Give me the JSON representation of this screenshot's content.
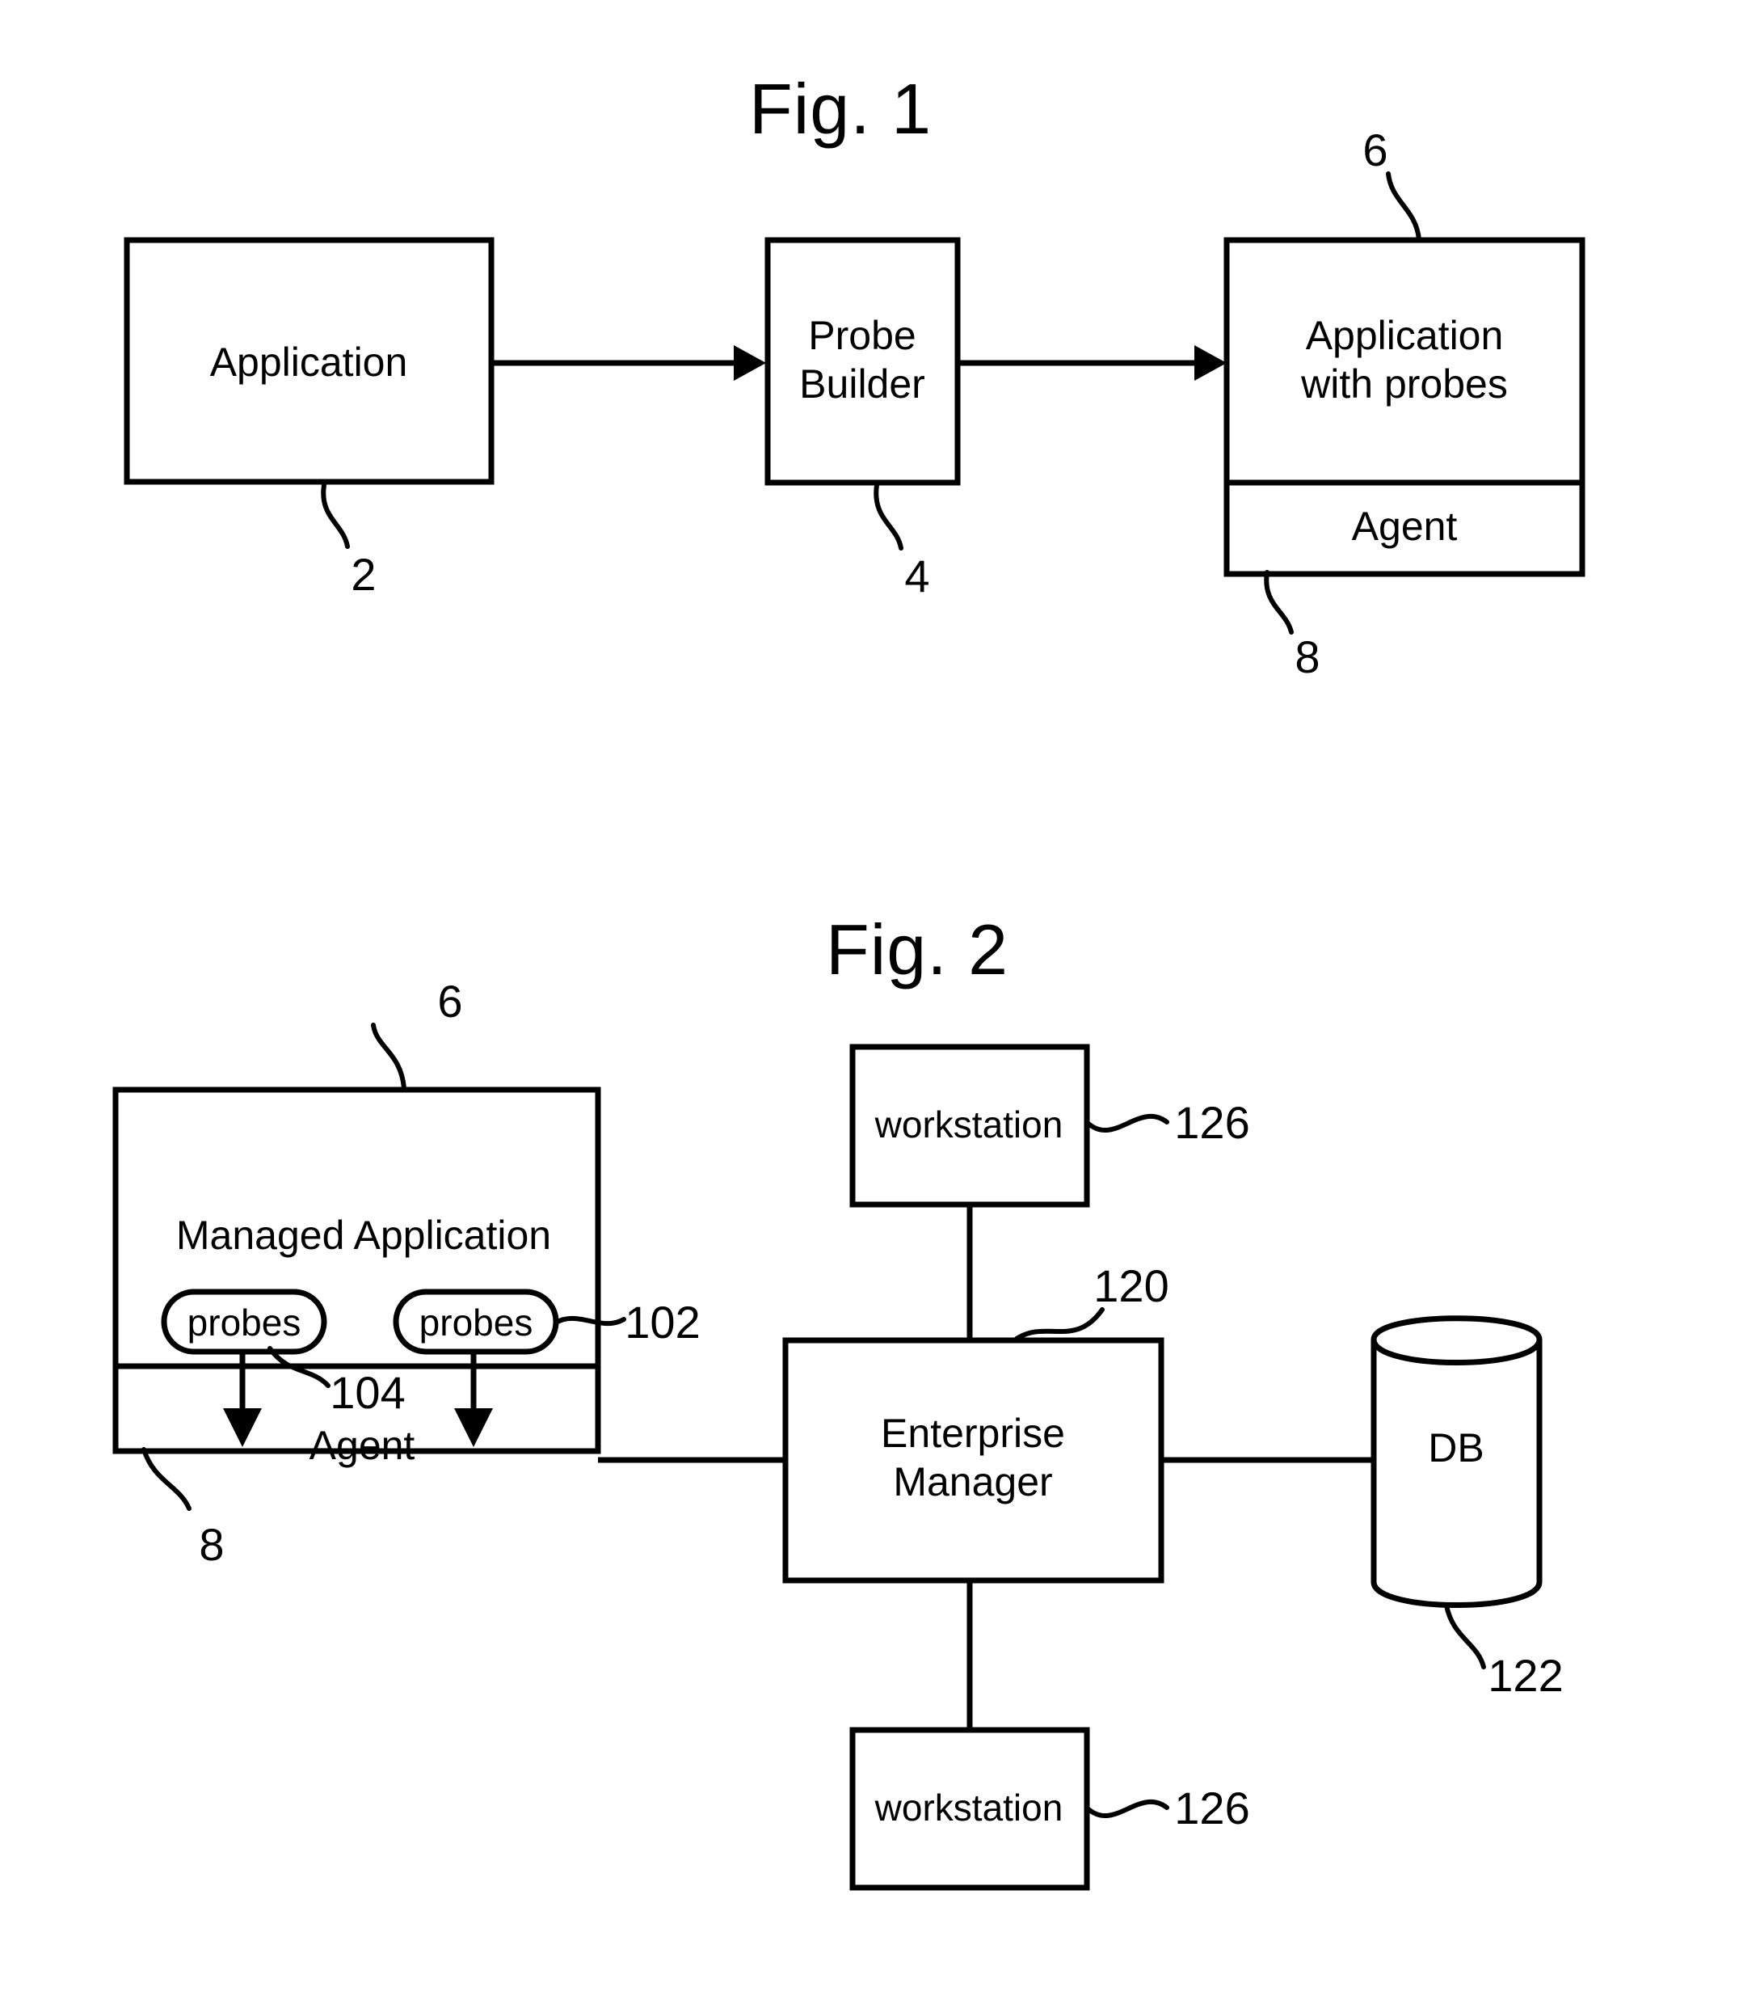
{
  "document": {
    "type": "patent-drawing-sheet",
    "figures": [
      {
        "id": "fig1",
        "title": "Fig. 1",
        "nodes": [
          {
            "id": "application",
            "label": "Application",
            "ref": "2"
          },
          {
            "id": "probe-builder",
            "label_line1": "Probe",
            "label_line2": "Builder",
            "ref": "4"
          },
          {
            "id": "application-with-probes",
            "label_line1": "Application",
            "label_line2": "with probes",
            "ref": "6"
          },
          {
            "id": "agent",
            "label": "Agent",
            "ref": "8"
          }
        ],
        "connections": [
          {
            "from": "application",
            "to": "probe-builder",
            "style": "arrow"
          },
          {
            "from": "probe-builder",
            "to": "application-with-probes",
            "style": "arrow"
          }
        ]
      },
      {
        "id": "fig2",
        "title": "Fig. 2",
        "nodes": [
          {
            "id": "managed-application",
            "label": "Managed Application",
            "ref": "6"
          },
          {
            "id": "probes-left",
            "label": "probes",
            "ref": "104"
          },
          {
            "id": "probes-right",
            "label": "probes",
            "ref": "102"
          },
          {
            "id": "agent",
            "label": "Agent",
            "ref": "8"
          },
          {
            "id": "workstation-top",
            "label": "workstation",
            "ref": "126"
          },
          {
            "id": "enterprise-manager",
            "label_line1": "Enterprise",
            "label_line2": "Manager",
            "ref": "120"
          },
          {
            "id": "database",
            "label": "DB",
            "ref": "122"
          },
          {
            "id": "workstation-bottom",
            "label": "workstation",
            "ref": "126"
          }
        ],
        "connections": [
          {
            "from": "agent",
            "to": "enterprise-manager",
            "style": "line"
          },
          {
            "from": "workstation-top",
            "to": "enterprise-manager",
            "style": "line"
          },
          {
            "from": "enterprise-manager",
            "to": "database",
            "style": "line"
          },
          {
            "from": "enterprise-manager",
            "to": "workstation-bottom",
            "style": "line"
          },
          {
            "from": "probes-left",
            "to": "agent",
            "style": "arrow-down"
          },
          {
            "from": "probes-right",
            "to": "agent",
            "style": "arrow-down"
          }
        ]
      }
    ]
  },
  "colors": {
    "ink": "#000000",
    "paper": "#ffffff"
  }
}
